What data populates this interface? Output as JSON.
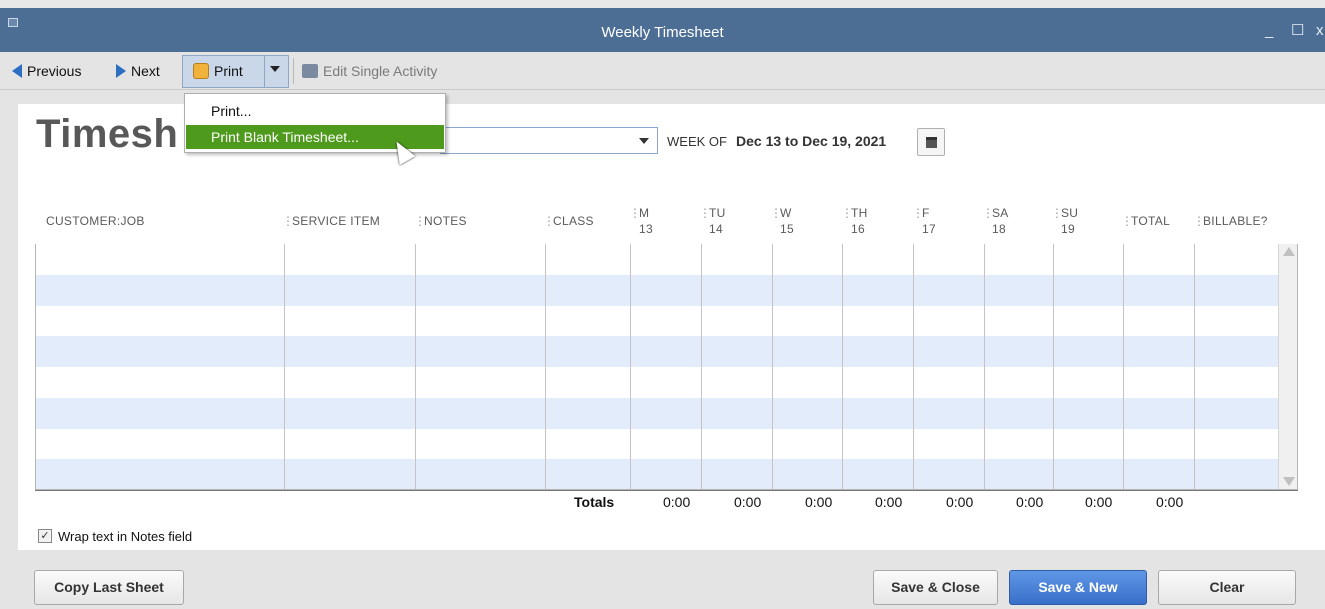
{
  "window": {
    "title": "Weekly Timesheet",
    "controls": [
      "_",
      "☐",
      "x"
    ]
  },
  "toolbar": {
    "previous_label": "Previous",
    "next_label": "Next",
    "print_label": "Print",
    "edit_label": "Edit Single Activity"
  },
  "print_menu": {
    "items": [
      "Print...",
      "Print Blank Timesheet..."
    ],
    "highlighted": 1
  },
  "header": {
    "title": "Timesh",
    "name_value": "",
    "week_of_label": "WEEK OF",
    "week_of_value": "Dec 13 to Dec 19, 2021"
  },
  "columns": {
    "customer_job": "CUSTOMER:JOB",
    "service_item": "SERVICE ITEM",
    "notes": "NOTES",
    "class": "CLASS",
    "days": [
      {
        "day": "M",
        "date": "13"
      },
      {
        "day": "TU",
        "date": "14"
      },
      {
        "day": "W",
        "date": "15"
      },
      {
        "day": "TH",
        "date": "16"
      },
      {
        "day": "F",
        "date": "17"
      },
      {
        "day": "SA",
        "date": "18"
      },
      {
        "day": "SU",
        "date": "19"
      }
    ],
    "total": "TOTAL",
    "billable": "BILLABLE?"
  },
  "totals": {
    "label": "Totals",
    "days": [
      "0:00",
      "0:00",
      "0:00",
      "0:00",
      "0:00",
      "0:00",
      "0:00"
    ],
    "total": "0:00"
  },
  "options": {
    "wrap_text_label": "Wrap text in Notes field",
    "wrap_text_checked": true
  },
  "buttons": {
    "copy_last_sheet": "Copy Last Sheet",
    "save_close": "Save & Close",
    "save_new": "Save & New",
    "clear": "Clear"
  },
  "colors": {
    "titlebar": "#4d6e94",
    "highlight": "#4e9a1c",
    "row_alt": "#e2ecfb",
    "primary_button": "#3a6fc9"
  }
}
